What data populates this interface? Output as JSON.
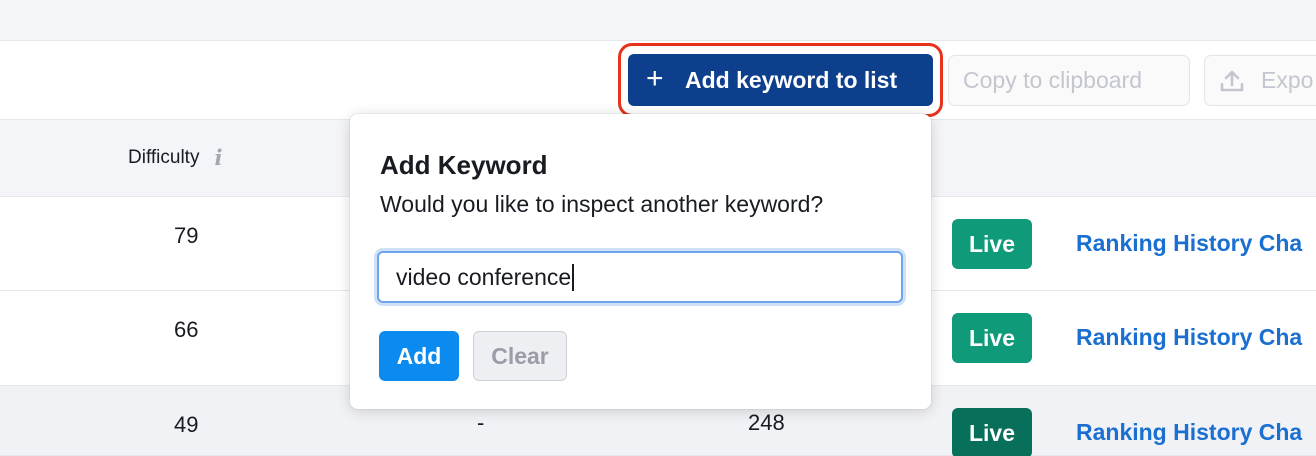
{
  "toolbar": {
    "add_keyword_label": "Add keyword to list",
    "add_keyword_icon": "plus-icon",
    "copy_label": "Copy to clipboard",
    "export_label": "Expo",
    "export_icon": "upload-icon"
  },
  "table": {
    "columns": {
      "difficulty": "Difficulty",
      "difficulty_icon": "info-icon"
    },
    "rows": [
      {
        "difficulty": "79",
        "status": "Live",
        "link": "Ranking History Cha"
      },
      {
        "difficulty": "66",
        "status": "Live",
        "link": "Ranking History Cha"
      },
      {
        "difficulty": "49",
        "col2": "-",
        "col3": "248",
        "status": "Live",
        "link": "Ranking History Cha"
      }
    ]
  },
  "popover": {
    "title": "Add Keyword",
    "subtitle": "Would you like to inspect another keyword?",
    "input_value": "video conference",
    "add_label": "Add",
    "clear_label": "Clear"
  },
  "colors": {
    "primary_button": "#0e3f8c",
    "highlight": "#e8321c",
    "live_badge": "#0f9b7a",
    "link": "#1a6fd1",
    "add_button": "#0b8bf0"
  }
}
